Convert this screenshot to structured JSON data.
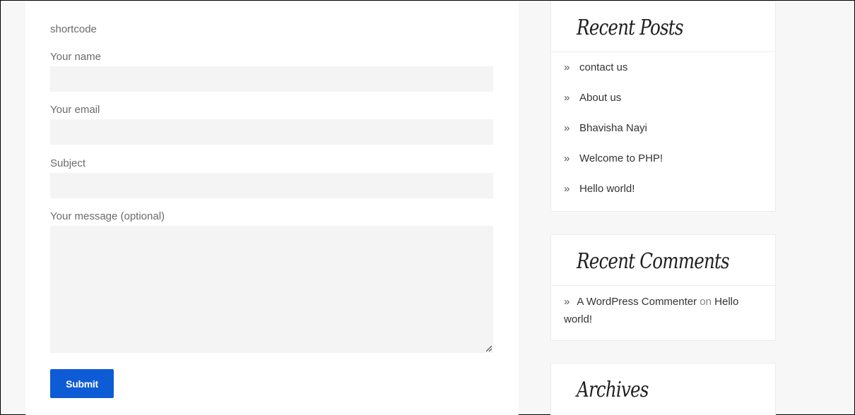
{
  "form": {
    "shortcode": "shortcode",
    "name_label": "Your name",
    "email_label": "Your email",
    "subject_label": "Subject",
    "message_label": "Your message (optional)",
    "name_value": "",
    "email_value": "",
    "subject_value": "",
    "message_value": "",
    "submit_label": "Submit"
  },
  "sidebar": {
    "recent_posts": {
      "title": "Recent Posts",
      "items": [
        "contact us",
        "About us",
        "Bhavisha Nayi",
        "Welcome to PHP!",
        "Hello world!"
      ]
    },
    "recent_comments": {
      "title": "Recent Comments",
      "author": "A WordPress Commenter",
      "on": "on",
      "post": "Hello world!"
    },
    "archives": {
      "title": "Archives"
    }
  },
  "colors": {
    "accent": "#0e5bd6",
    "field_bg": "#f4f4f4",
    "page_bg": "#f7f7f7"
  },
  "icons": {
    "list_bullet": "chevron-double-right-icon"
  }
}
